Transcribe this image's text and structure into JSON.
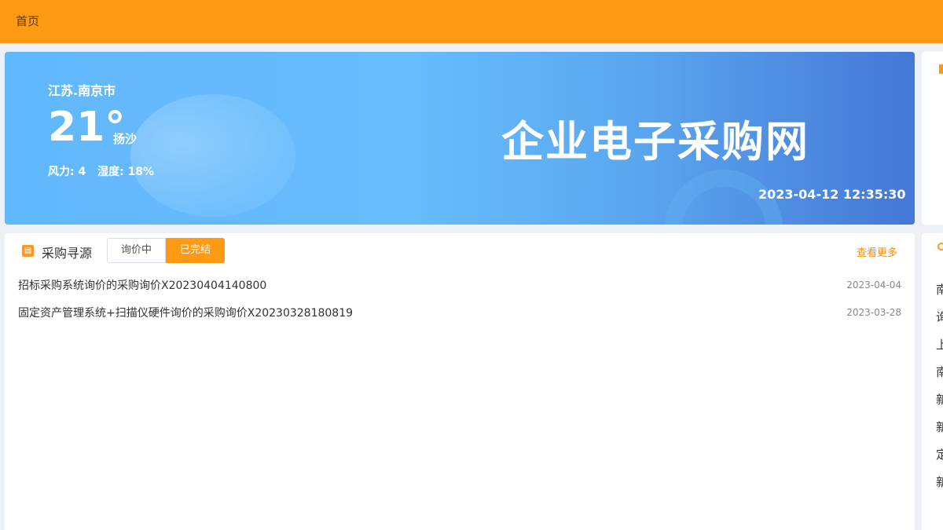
{
  "header": {
    "breadcrumb": "首页"
  },
  "banner": {
    "city": "江苏.南京市",
    "temperature": "21°",
    "condition": "扬沙",
    "wind": "风力: 4",
    "humidity": "湿度: 18%",
    "brand": "企业电子采购网",
    "datetime": "2023-04-12 12:35:30"
  },
  "sourcing": {
    "title": "采购寻源",
    "tabs": [
      {
        "label": "询价中",
        "active": false
      },
      {
        "label": "已完结",
        "active": true
      }
    ],
    "more_label": "查看更多",
    "items": [
      {
        "title": "招标采购系统询价的采购询价X20230404140800",
        "date": "2023-04-04"
      },
      {
        "title": "固定资产管理系统+扫描仪硬件询价的采购询价X20230328180819",
        "date": "2023-03-28"
      }
    ]
  },
  "side_list_glyphs": [
    "南",
    "询",
    "上",
    "南",
    "新",
    "新",
    "定",
    "新"
  ],
  "colors": {
    "accent": "#ff9a14",
    "banner_start": "#62b8fc",
    "banner_end": "#4477d6"
  }
}
